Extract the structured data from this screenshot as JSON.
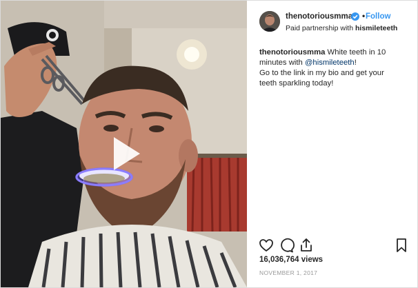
{
  "post": {
    "username": "thenotoriousmma",
    "separator": "•",
    "follow_label": "Follow",
    "partnership_prefix": "Paid partnership with",
    "partner_handle": "hismileteeth",
    "caption_user": "thenotoriousmma",
    "caption_part1": "White teeth in 10 minutes with",
    "caption_mention": "@hismileteeth",
    "caption_part2": "!",
    "caption_part3": "Go to the link in my bio and get your teeth sparkling today!",
    "views": "16,036,764 views",
    "date": "NOVEMBER 1, 2017"
  },
  "icons": {
    "verified": "verified-badge-icon",
    "play": "play-icon",
    "like": "heart-icon",
    "comment": "comment-icon",
    "share": "share-icon",
    "save": "bookmark-icon"
  },
  "colors": {
    "accent": "#3897f0",
    "mention": "#003569",
    "text": "#262626",
    "muted": "#999999",
    "led": "#6b5cff"
  }
}
